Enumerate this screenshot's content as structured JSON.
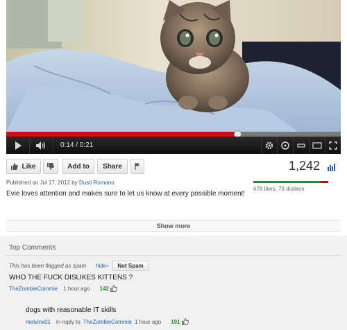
{
  "player": {
    "time": "0:14 / 0:21",
    "progress_fraction": 0.69,
    "buffered_fraction": 1.0
  },
  "actions": {
    "like_label": "Like",
    "add_to_label": "Add to",
    "share_label": "Share",
    "view_count": "1,242"
  },
  "video": {
    "published_prefix": "Published on Jul 17, 2012 by ",
    "uploader": "Dusti Romano",
    "description": "Evie loves attention and makes sure to let us know at every possible moment!",
    "likes_dislikes": "678 likes, 79 dislikes",
    "like_fraction": 0.896,
    "show_more_label": "Show more"
  },
  "comments": {
    "section_title": "Top Comments",
    "flagged_text": "This has been flagged as spam",
    "hide_label": "hide",
    "not_spam_label": "Not Spam",
    "items": [
      {
        "text": "WHO THE FUCK DISLIKES KITTENS ?",
        "author": "TheZombieCommie",
        "time": "1 hour ago",
        "score": "142"
      },
      {
        "text": "dogs with reasonable IT skills",
        "author": "melvinx01",
        "reply_prefix": "in reply to",
        "reply_to": "TheZombieCommie",
        "time": "1 hour ago",
        "score": "191"
      }
    ]
  },
  "colors": {
    "progress_red": "#c4120c",
    "link_blue": "#1c62b9",
    "score_green": "#2a8c2a"
  }
}
